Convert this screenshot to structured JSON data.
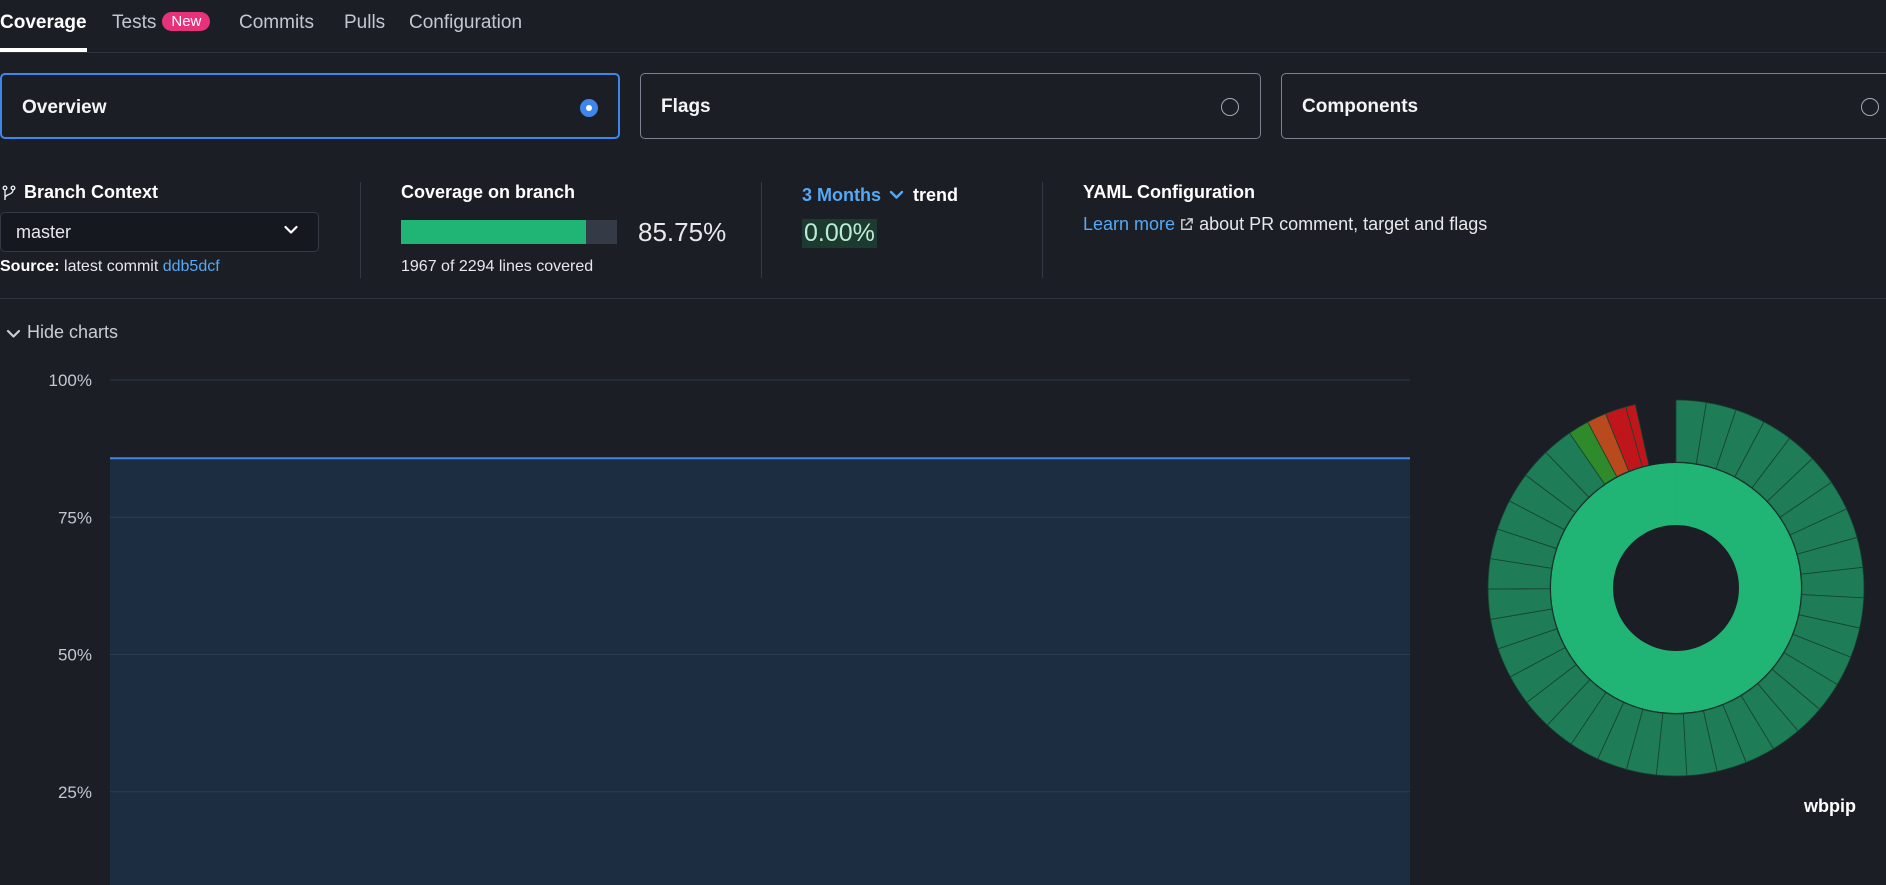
{
  "tabs": [
    {
      "label": "Coverage",
      "active": true
    },
    {
      "label": "Tests",
      "badge": "New"
    },
    {
      "label": "Commits"
    },
    {
      "label": "Pulls"
    },
    {
      "label": "Configuration"
    }
  ],
  "view_cards": [
    {
      "label": "Overview",
      "selected": true
    },
    {
      "label": "Flags",
      "selected": false
    },
    {
      "label": "Components",
      "selected": false
    }
  ],
  "branch": {
    "heading": "Branch Context",
    "selected": "master",
    "source_label": "Source:",
    "source_text": "latest commit",
    "commit": "ddb5dcf"
  },
  "coverage": {
    "heading": "Coverage on branch",
    "percent": "85.75%",
    "fraction": 0.8575,
    "lines_text": "1967 of 2294 lines covered"
  },
  "trend": {
    "period": "3 Months",
    "word": "trend",
    "value": "0.00%"
  },
  "yaml": {
    "heading": "YAML Configuration",
    "link": "Learn more",
    "text": "about PR comment, target and flags"
  },
  "charts_toggle": "Hide charts",
  "colors": {
    "accent": "#3e86e9",
    "link": "#56a8f5",
    "coverage_green": "#21b575",
    "chart_line": "#3e86e9",
    "chart_fill": "#1c2e43"
  },
  "chart_data": {
    "type": "area",
    "y_ticks": [
      "100%",
      "75%",
      "50%",
      "25%"
    ],
    "ylim": [
      0,
      100
    ],
    "series": [
      {
        "values": [
          85.75,
          85.75
        ]
      }
    ],
    "grid": true
  },
  "sunburst": {
    "label": "wbpip"
  }
}
